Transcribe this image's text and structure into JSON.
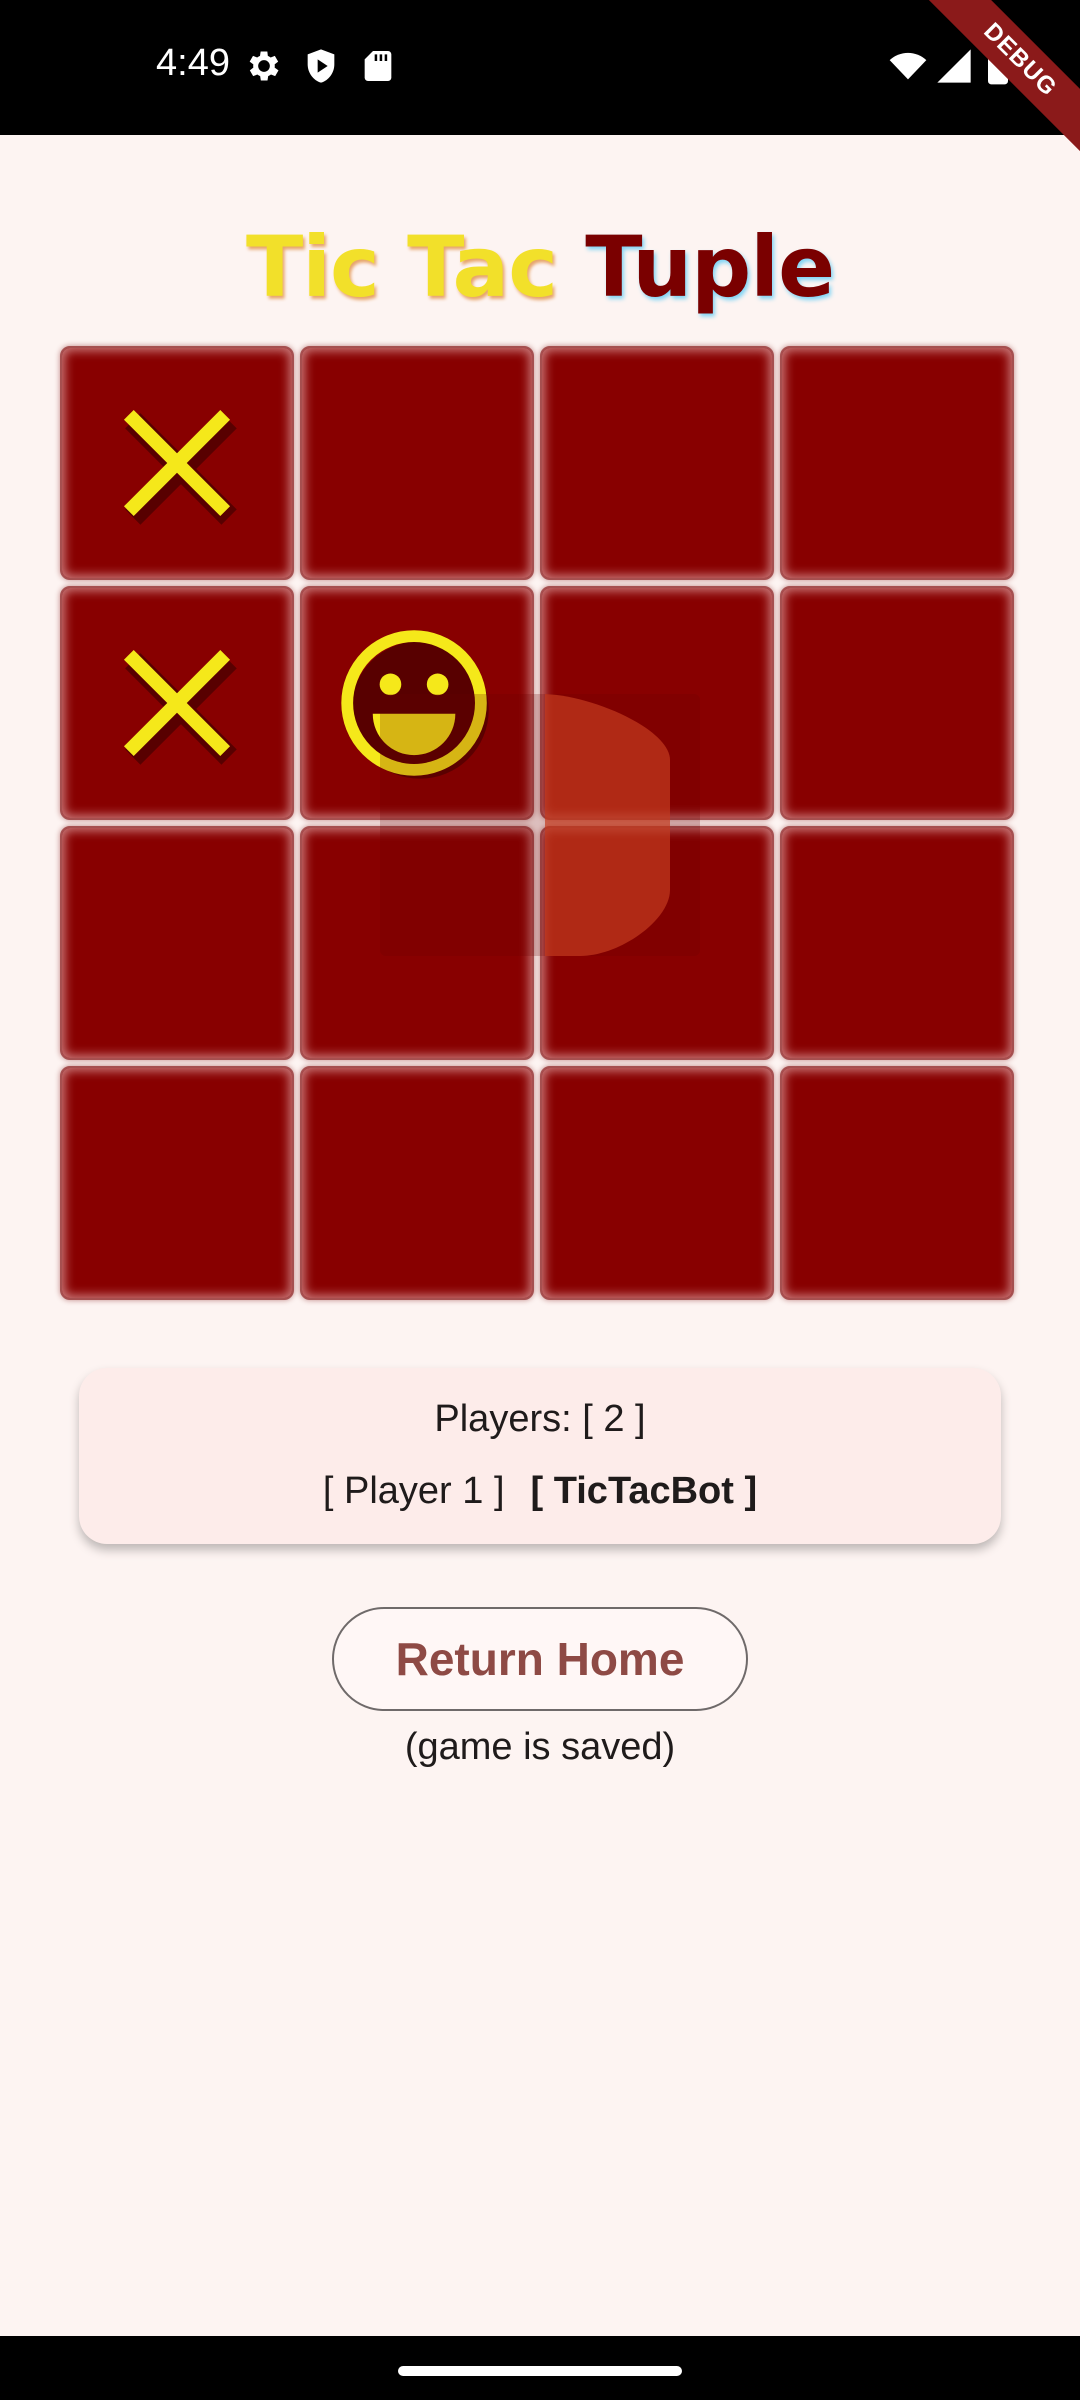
{
  "status_bar": {
    "time": "4:49",
    "debug_label": "DEBUG",
    "left_icons": [
      "gear-icon",
      "shield-play-icon",
      "sd-card-icon"
    ],
    "right_icons": [
      "wifi-icon",
      "signal-icon",
      "battery-icon"
    ]
  },
  "title": {
    "part1": "Tic Tac",
    "part2": "Tuple"
  },
  "board": {
    "size": 4,
    "cells": [
      [
        "X",
        "",
        "",
        ""
      ],
      [
        "X",
        "smiley",
        "",
        ""
      ],
      [
        "",
        "",
        "",
        ""
      ],
      [
        "",
        "",
        "",
        ""
      ]
    ]
  },
  "info": {
    "players_count": "Players: [ 2 ]",
    "player1": "[ Player 1 ]",
    "player2": "[ TicTacBot ]"
  },
  "actions": {
    "return_home": "Return Home",
    "saved_note": "(game is saved)"
  },
  "colors": {
    "cell": "#880000",
    "mark": "#f5e81a",
    "title_yellow": "#f2e02a",
    "title_dark": "#7a0000",
    "button_text": "#8e4a45"
  }
}
